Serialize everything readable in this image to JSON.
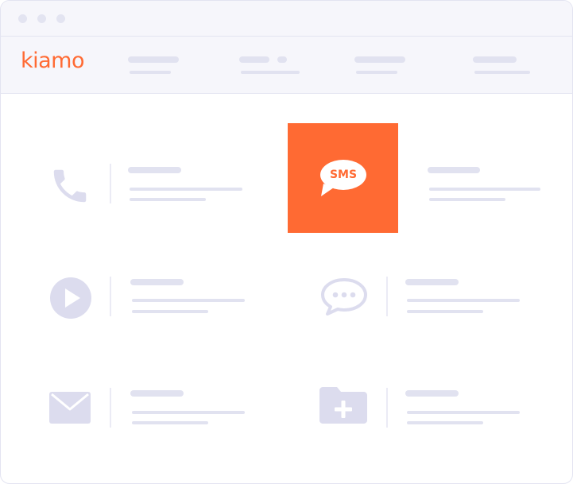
{
  "app": {
    "logo_text": "kiamo",
    "brand_color": "#ff6a33"
  },
  "window": {
    "controls": [
      "close-dot",
      "minimize-dot",
      "maximize-dot"
    ]
  },
  "nav": {
    "items": [
      "nav-item-1",
      "nav-item-2",
      "nav-item-3",
      "nav-item-4"
    ]
  },
  "channels": [
    {
      "id": "phone",
      "icon": "phone-icon",
      "highlighted": false
    },
    {
      "id": "sms",
      "icon": "sms-bubble-icon",
      "label": "SMS",
      "highlighted": true
    },
    {
      "id": "video",
      "icon": "play-icon",
      "highlighted": false
    },
    {
      "id": "chat",
      "icon": "chat-bubble-icon",
      "highlighted": false
    },
    {
      "id": "email",
      "icon": "envelope-icon",
      "highlighted": false
    },
    {
      "id": "new-folder",
      "icon": "folder-plus-icon",
      "highlighted": false
    }
  ],
  "colors": {
    "placeholder": "#e1e2f0",
    "icon": "#dcdcee",
    "chrome": "#f6f6fb",
    "border": "#e3e4f1"
  }
}
